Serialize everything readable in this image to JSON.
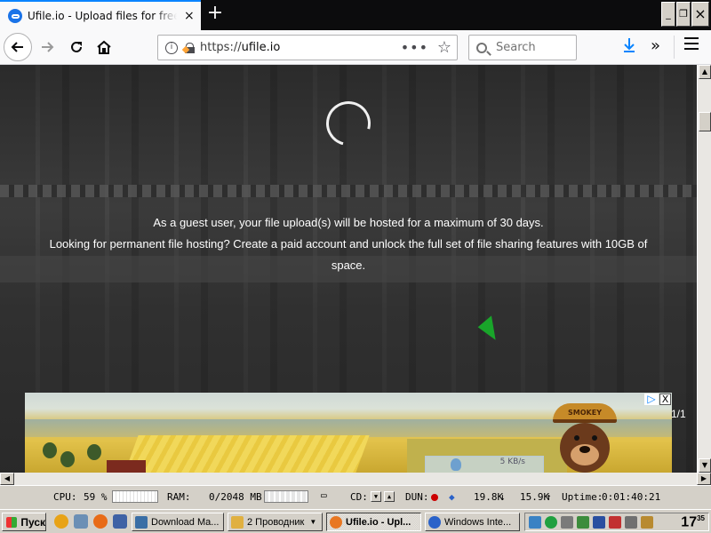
{
  "browser": {
    "tab_title": "Ufile.io - Upload files for free & share",
    "tab_close": "×",
    "new_tab": "+",
    "url_prefix": "https://",
    "url_host": "ufile.io",
    "page_actions": "•••",
    "search_placeholder": "Search",
    "window_buttons": [
      "_",
      "❐",
      "×"
    ]
  },
  "page": {
    "line1": "As a guest user, your file upload(s) will be hosted for a maximum of 30 days.",
    "line2": "Looking for permanent file hosting? Create a paid account and unlock the full set of file sharing features with 10GB of space."
  },
  "ad": {
    "bear_hat_text": "SMOKEY",
    "adchoices_icon": "▷",
    "close": "X",
    "pager": "1/1"
  },
  "net_meter": {
    "rate": "5 KB/s"
  },
  "sysmon": {
    "cpu_label": "CPU:",
    "cpu_value": "59 %",
    "ram_label": "RAM:",
    "ram_value": "0/2048 MB",
    "cd_label": "CD:",
    "dun_label": "DUN:",
    "down_rate": "19.8K",
    "up_rate": "15.9K",
    "uptime_label": "Uptime:",
    "uptime_value": "0:01:40:21"
  },
  "taskbar": {
    "start_label": "Пуск",
    "buttons": [
      {
        "label": "Download Ma...",
        "color": "#3a6ea5"
      },
      {
        "label": "2 Проводник",
        "color": "#e0b040"
      },
      {
        "label": "Ufile.io - Upl...",
        "color": "#e87722"
      },
      {
        "label": "Windows Inte...",
        "color": "#2a62c9"
      }
    ],
    "clock_main": "17",
    "clock_minutes": "35"
  }
}
